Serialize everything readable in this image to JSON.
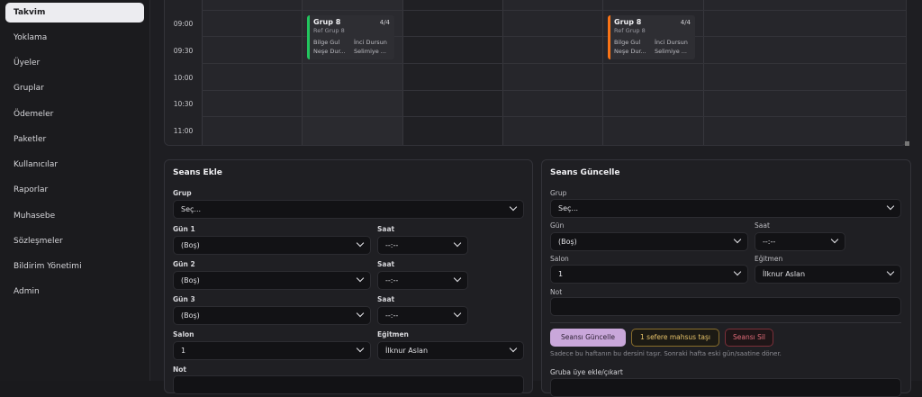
{
  "sidebar": {
    "items": [
      {
        "label": "Takvim"
      },
      {
        "label": "Yoklama"
      },
      {
        "label": "Üyeler"
      },
      {
        "label": "Gruplar"
      },
      {
        "label": "Ödemeler"
      },
      {
        "label": "Paketler"
      },
      {
        "label": "Kullanıcılar"
      },
      {
        "label": "Raporlar"
      },
      {
        "label": "Muhasebe"
      },
      {
        "label": "Sözleşmeler"
      },
      {
        "label": "Bildirim Yönetimi"
      },
      {
        "label": "Admin"
      }
    ]
  },
  "calendar": {
    "times": [
      "09:00",
      "09:30",
      "10:00",
      "10:30",
      "11:00"
    ],
    "events": [
      {
        "title": "Grup 8",
        "count": "4/4",
        "subtitle": "Ref Grup 8",
        "p1": "Bilge Gul",
        "p2": "İnci Dursun",
        "p3": "Neşe Dur...",
        "p4": "Selimiye ...",
        "color": "#22c55e"
      },
      {
        "title": "Grup 8",
        "count": "4/4",
        "subtitle": "Ref Grup 8",
        "p1": "Bilge Gul",
        "p2": "İnci Dursun",
        "p3": "Neşe Dur...",
        "p4": "Selimiye ...",
        "color": "#f97316"
      }
    ]
  },
  "add_session": {
    "title": "Seans Ekle",
    "group_label": "Grup",
    "group_value": "Seç...",
    "day1_label": "Gün 1",
    "day1_value": "(Boş)",
    "time1_label": "Saat",
    "time1_value": "--:--",
    "day2_label": "Gün 2",
    "day2_value": "(Boş)",
    "time2_label": "Saat",
    "time2_value": "--:--",
    "day3_label": "Gün 3",
    "day3_value": "(Boş)",
    "time3_label": "Saat",
    "time3_value": "--:--",
    "room_label": "Salon",
    "room_value": "1",
    "trainer_label": "Eğitmen",
    "trainer_value": "İlknur Aslan",
    "note_label": "Not"
  },
  "update_session": {
    "title": "Seans Güncelle",
    "group_label": "Grup",
    "group_value": "Seç...",
    "day_label": "Gün",
    "day_value": "(Boş)",
    "time_label": "Saat",
    "time_value": "--:--",
    "room_label": "Salon",
    "room_value": "1",
    "trainer_label": "Eğitmen",
    "trainer_value": "İlknur Aslan",
    "note_label": "Not",
    "btn_update": "Seansı Güncelle",
    "btn_once": "1 sefere mahsus taşı",
    "btn_delete": "Seansı Sil",
    "hint": "Sadece bu haftanın bu dersini taşır. Sonraki hafta eski gün/saatine döner.",
    "member_label": "Gruba üye ekle/çıkart"
  }
}
